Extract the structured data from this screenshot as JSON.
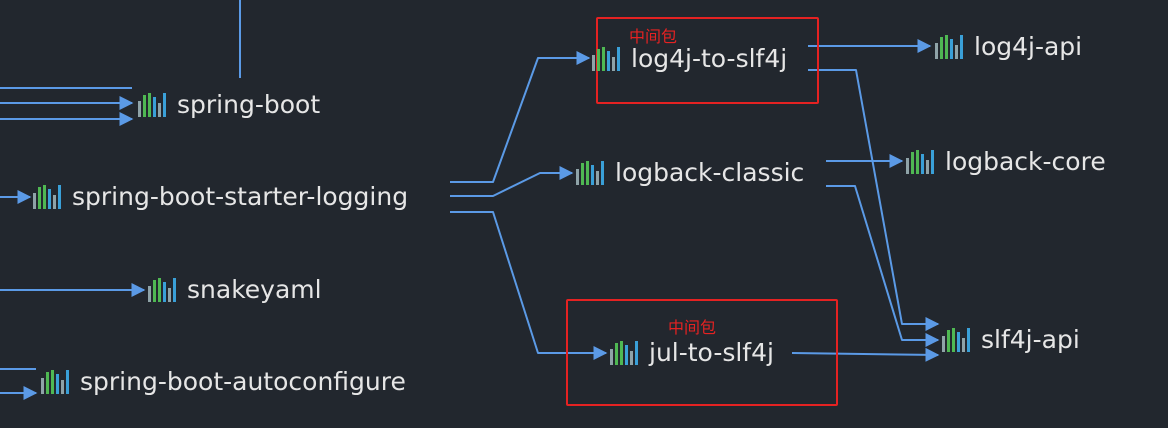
{
  "colors": {
    "background": "#22272e",
    "edge": "#5b9ae6",
    "text": "#e6e6e6",
    "highlight": "#e52222",
    "icon_bars": [
      "#8fa3a8",
      "#4fb853",
      "#4fb853",
      "#3aa0d8",
      "#8fa3a8",
      "#3aa0d8"
    ]
  },
  "icon": "maven-artifact-icon",
  "nodes": {
    "spring_boot": "spring-boot",
    "spring_boot_starter_logging": "spring-boot-starter-logging",
    "snakeyaml": "snakeyaml",
    "spring_boot_autoconfigure": "spring-boot-autoconfigure",
    "log4j_to_slf4j": "log4j-to-slf4j",
    "logback_classic": "logback-classic",
    "jul_to_slf4j": "jul-to-slf4j",
    "log4j_api": "log4j-api",
    "logback_core": "logback-core",
    "slf4j_api": "slf4j-api"
  },
  "annotations": {
    "log4j_to_slf4j_note": "中间包",
    "jul_to_slf4j_note": "中间包"
  },
  "edges": [
    {
      "from": "spring_boot_starter_logging",
      "to": "log4j_to_slf4j"
    },
    {
      "from": "spring_boot_starter_logging",
      "to": "logback_classic"
    },
    {
      "from": "spring_boot_starter_logging",
      "to": "jul_to_slf4j"
    },
    {
      "from": "log4j_to_slf4j",
      "to": "log4j_api"
    },
    {
      "from": "log4j_to_slf4j",
      "to": "slf4j_api"
    },
    {
      "from": "logback_classic",
      "to": "logback_core"
    },
    {
      "from": "logback_classic",
      "to": "slf4j_api"
    },
    {
      "from": "jul_to_slf4j",
      "to": "slf4j_api"
    }
  ]
}
